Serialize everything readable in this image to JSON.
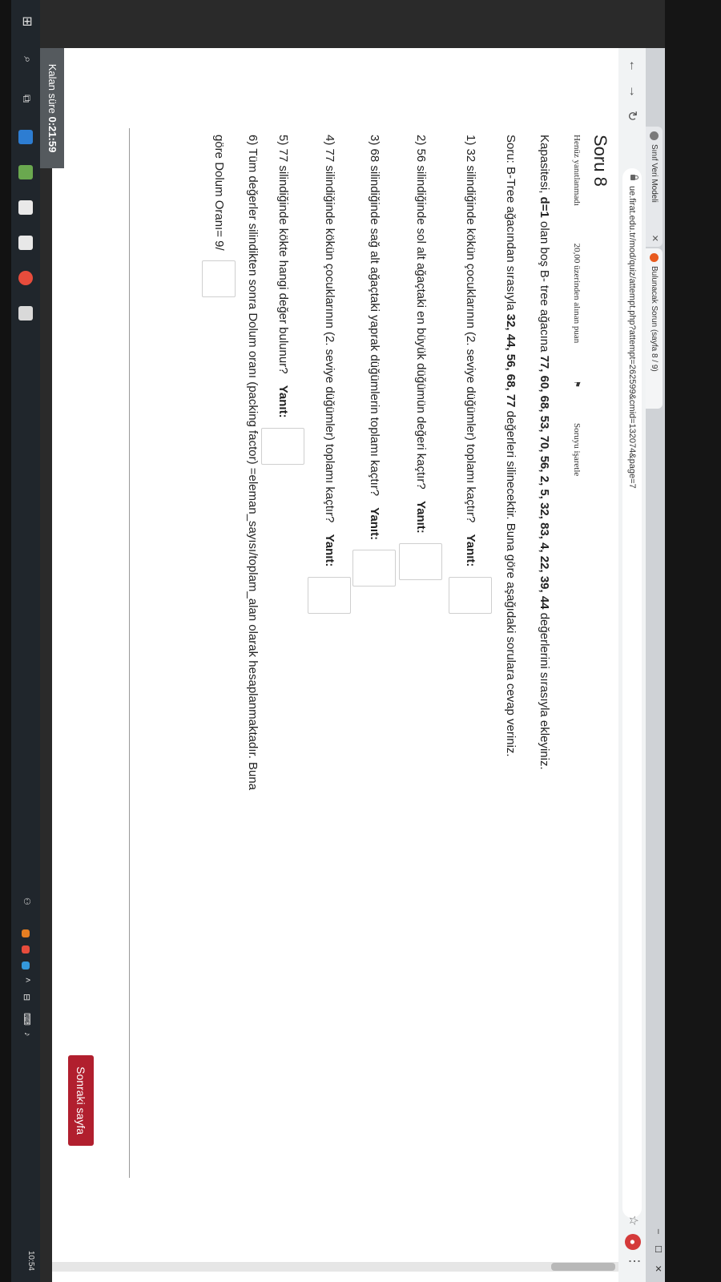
{
  "browser": {
    "tabs": [
      {
        "title": "Sınıf Veri Modeli"
      },
      {
        "title": "Bulunacak Sorun (sayfa 8 / 9)"
      }
    ],
    "url": "ue.firat.edu.tr/mod/quiz/attempt.php?attempt=262599&cmid=132074&page=7"
  },
  "question": {
    "title": "Soru 8",
    "status": "Henüz yanıtlanmadı",
    "points": "20,00 üzerinden alınan puan",
    "flag_label": "Soruyu işaretle",
    "intro": {
      "prefix": "Kapasitesi,",
      "d": "d=1",
      "mid": "olan boş B- tree ağacına",
      "values": "77, 60, 68, 53, 70, 56, 2, 5, 32, 83, 4, 22, 39, 44",
      "suffix": "değerlerini sırasıyla ekleyiniz."
    },
    "task": {
      "prefix": "Soru: B-Tree ağacından sırasıyla",
      "values": "32, 44, 56, 68, 77",
      "suffix": "değerleri silinecektir. Buna göre aşağıdaki sorulara cevap veriniz."
    },
    "items": [
      {
        "text": "1) 32 silindiğinde kökün çocuklarının (2. seviye düğümler) toplamı kaçtır?",
        "answer_label": "Yanıt:"
      },
      {
        "text": "2) 56 silindiğinde sol alt ağaçtaki en büyük düğümün değeri kaçtır?",
        "answer_label": "Yanıt:"
      },
      {
        "text": "3) 68 silindiğinde sağ alt ağaçtaki yaprak düğümlerin toplamı kaçtır?",
        "answer_label": "Yanıt:"
      },
      {
        "text": "4) 77 silindiğinde kökün çocuklarının (2. seviye düğümler) toplamı kaçtır?",
        "answer_label": "Yanıt:"
      },
      {
        "text": "5) 77 silindiğinde kökte hangi değer bulunur?",
        "answer_label": "Yanıt:"
      }
    ],
    "item6": {
      "line1": "6) Tüm değerler silindikten sonra Dolum oranı (packing factor) =eleman_sayısı/toplam_alan olarak hesaplanmaktadır. Buna",
      "line2_prefix": "göre Dolum Oranı= 9/"
    },
    "next_button": "Sonraki sayfa"
  },
  "timer": {
    "label": "Kalan süre",
    "value": "0:21:59"
  },
  "taskbar": {
    "clock_time": "10:54"
  }
}
